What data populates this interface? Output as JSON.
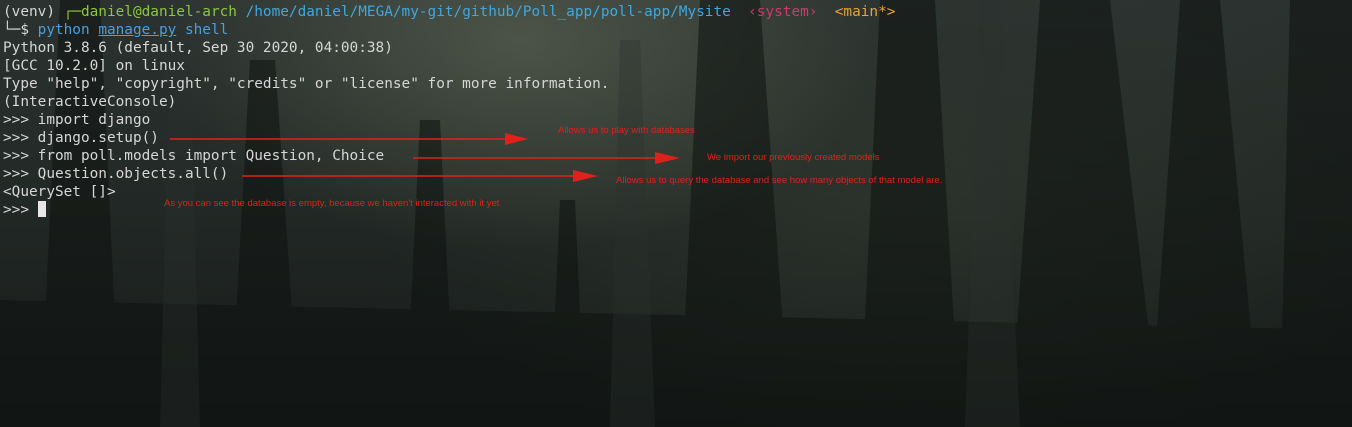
{
  "prompt": {
    "venv": "(venv) ",
    "corner": "┌─",
    "user_host": "daniel@daniel-arch",
    "cwd": "/home/daniel/MEGA/my-git/github/Poll_app/poll-app/Mysite",
    "python_env": "‹system›",
    "git_branch": "<main*>",
    "prompt_arrow": "└─$ ",
    "cmd_python": "python",
    "cmd_file": "manage.py",
    "cmd_arg": "shell"
  },
  "output": [
    "Python 3.8.6 (default, Sep 30 2020, 04:00:38)",
    "[GCC 10.2.0] on linux",
    "Type \"help\", \"copyright\", \"credits\" or \"license\" for more information.",
    "(InteractiveConsole)",
    ">>> import django",
    ">>> django.setup()",
    ">>> from poll.models import Question, Choice",
    ">>> Question.objects.all()",
    "<QuerySet []>"
  ],
  "active_prompt": ">>> ",
  "annotations": {
    "setup_note": "Allows us to play with databases",
    "models_note": "We import our previously created models",
    "query_note": "Allows us to query the database and see how many objects of that model are.",
    "empty_note": "As you can see the database is empty, because we haven't interacted with it yet"
  },
  "colors": {
    "annotation_red": "#e0211b",
    "prompt_green": "#8cc63f",
    "path_blue": "#3ea8e0",
    "system_pink": "#d0386b",
    "branch_orange": "#e8a13c",
    "text": "#d6d6d6"
  }
}
